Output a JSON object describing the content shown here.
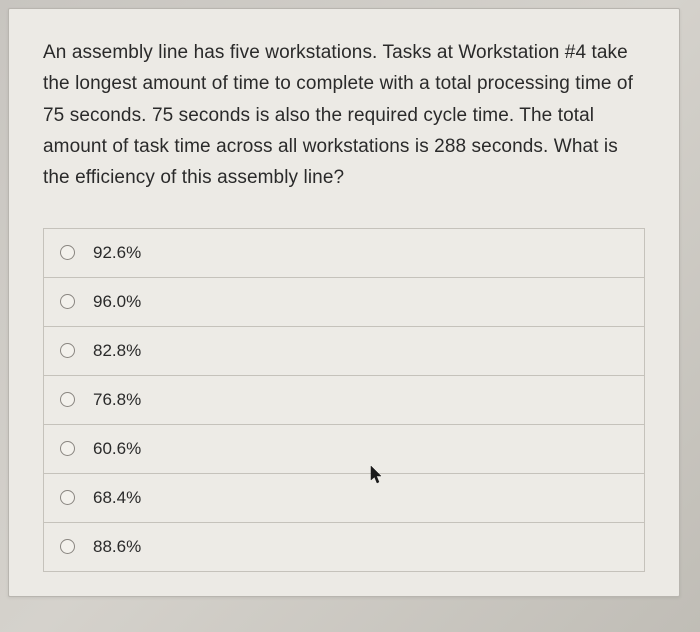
{
  "question": {
    "text": "An assembly line has five workstations. Tasks at Workstation #4 take the longest amount of time to complete with a total processing time of 75 seconds. 75 seconds is also the required cycle time. The total amount of task time across all workstations is 288 seconds. What is the efficiency of this assembly line?"
  },
  "options": [
    {
      "label": "92.6%"
    },
    {
      "label": "96.0%"
    },
    {
      "label": "82.8%"
    },
    {
      "label": "76.8%"
    },
    {
      "label": "60.6%"
    },
    {
      "label": "68.4%"
    },
    {
      "label": "88.6%"
    }
  ]
}
